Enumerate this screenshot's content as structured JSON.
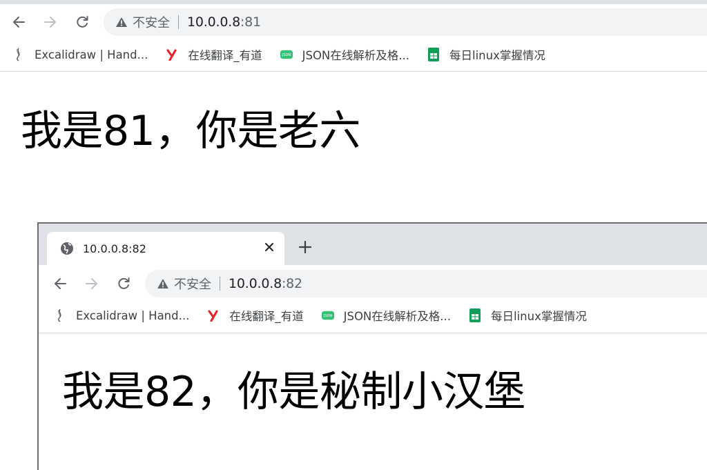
{
  "browser1": {
    "address": {
      "security_label": "不安全",
      "host": "10.0.0.8",
      "port": ":81"
    },
    "bookmarks": [
      {
        "label": "Excalidraw | Hand...",
        "icon": "excalidraw-icon"
      },
      {
        "label": "在线翻译_有道",
        "icon": "youdao-icon"
      },
      {
        "label": "JSON在线解析及格...",
        "icon": "json-icon"
      },
      {
        "label": "每日linux掌握情况",
        "icon": "sheets-icon"
      }
    ],
    "page_heading": "我是81，你是老六"
  },
  "browser2": {
    "tab": {
      "title": "10.0.0.8:82",
      "icon": "globe-icon"
    },
    "address": {
      "security_label": "不安全",
      "host": "10.0.0.8",
      "port": ":82"
    },
    "bookmarks": [
      {
        "label": "Excalidraw | Hand...",
        "icon": "excalidraw-icon"
      },
      {
        "label": "在线翻译_有道",
        "icon": "youdao-icon"
      },
      {
        "label": "JSON在线解析及格...",
        "icon": "json-icon"
      },
      {
        "label": "每日linux掌握情况",
        "icon": "sheets-icon"
      }
    ],
    "page_heading": "我是82，你是秘制小汉堡"
  },
  "colors": {
    "tabstrip": "#dee1e6",
    "omnibox": "#f1f3f4",
    "youdao_red": "#e0282e",
    "json_green": "#34c277",
    "sheets_green": "#0f9d58"
  }
}
